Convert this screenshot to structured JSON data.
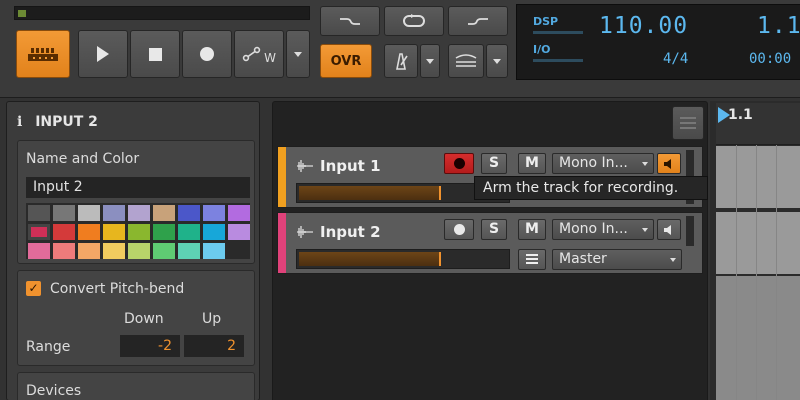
{
  "transport": {
    "buttons": [
      "play",
      "stop",
      "record",
      "automation-write"
    ],
    "automation_label": "W",
    "overdub_label": "OVR"
  },
  "display": {
    "dsp_label": "DSP",
    "io_label": "I/O",
    "tempo": "110.00",
    "time_signature": "4/4",
    "position": "1.1",
    "time": "00:00"
  },
  "inspector": {
    "title": "INPUT 2",
    "name_color": {
      "title": "Name and Color",
      "name_value": "Input 2",
      "swatches": [
        "#555555",
        "#777777",
        "#bbbbbb",
        "#8b8fc0",
        "#b2a3cf",
        "#c8a27a",
        "#4b57c9",
        "#7c82e0",
        "#b26be0",
        "#cf2f57",
        "#d43a3a",
        "#f07d1f",
        "#e7b61e",
        "#8ab72e",
        "#2fa14b",
        "#1fb28a",
        "#17a7d9",
        "#b98be0",
        "#e26b9a",
        "#ee7b7b",
        "#f3a766",
        "#f1cc5f",
        "#b8d36a",
        "#5fcb73",
        "#5ed2b4",
        "#6ccbef",
        "#2a2a2a"
      ]
    },
    "pitch_bend": {
      "checkbox_label": "Convert Pitch-bend",
      "checked": true,
      "down_label": "Down",
      "up_label": "Up",
      "range_label": "Range",
      "down_value": "-2",
      "up_value": "2"
    },
    "devices_label": "Devices"
  },
  "tracks": [
    {
      "name": "Input 1",
      "color": "#f0a020",
      "armed": true,
      "solo_label": "S",
      "mute_label": "M",
      "input": "Mono In...",
      "monitor_active": true,
      "fader_level": 0.66
    },
    {
      "name": "Input 2",
      "color": "#e0427a",
      "armed": false,
      "solo_label": "S",
      "mute_label": "M",
      "input": "Mono In...",
      "monitor_active": false,
      "output": "Master",
      "fader_level": 0.66
    }
  ],
  "tooltip": "Arm the track for recording.",
  "arranger": {
    "marker": "1.1"
  },
  "colors": {
    "accent": "#f0922e",
    "display_text": "#5cb8ef",
    "arm_red": "#d52d2d"
  }
}
